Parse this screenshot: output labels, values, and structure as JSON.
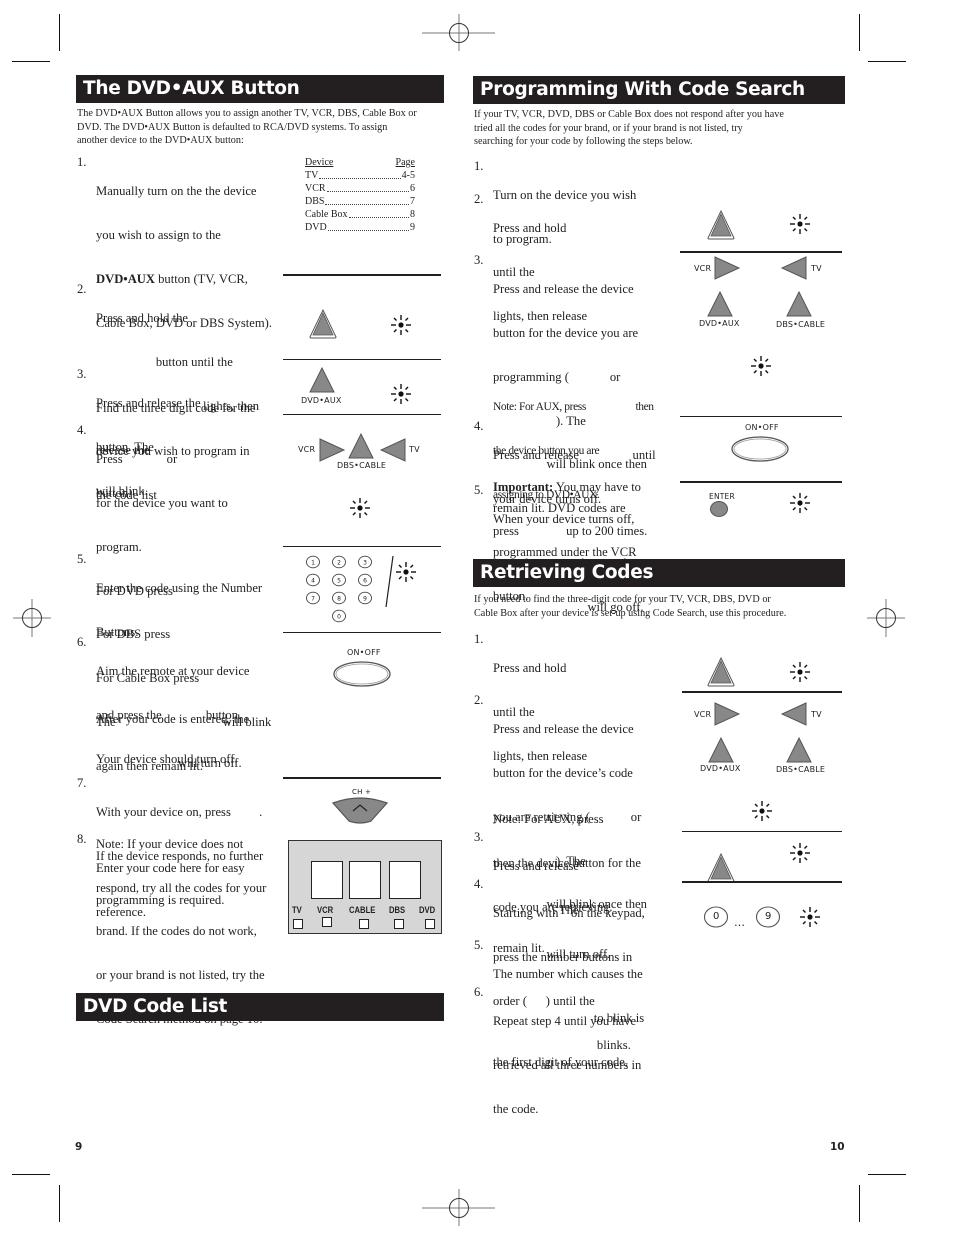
{
  "left_page": {
    "section_title": "The DVD•AUX Button",
    "intro": [
      "The DVD•AUX Button allows you to assign another TV, VCR, DBS, Cable Box or",
      "DVD. The DVD•AUX Button is defaulted to RCA/DVD systems.  To assign",
      "another device to the DVD•AUX button:"
    ],
    "steps": [
      {
        "num": "1.",
        "lines": [
          "Manually turn on the the device",
          "you wish to assign to the",
          "",
          "Cable Box, DVD or DBS System).",
          "",
          "Find the three digit code for the",
          "device you wish to program in",
          "the code list"
        ],
        "bold_line": "DVD•AUX",
        "bold_suffix": " button (TV, VCR,"
      },
      {
        "num": "2.",
        "lines": [
          "Press and hold the",
          "                   button until the",
          "                                  lights, then",
          "release the",
          "button."
        ]
      },
      {
        "num": "3.",
        "lines": [
          "Press and release the",
          "button. The",
          "will blink."
        ]
      },
      {
        "num": "4.",
        "lines": [
          "Press              or",
          "for the device you want to",
          "program.",
          "For DVD press",
          "For DBS press",
          "For Cable Box press",
          "The                                  will blink",
          "again then remain lit."
        ]
      },
      {
        "num": "5.",
        "lines": [
          "Enter the code using the Number",
          "Buttons.",
          "",
          "After your code is entered, the",
          "                          will turn off."
        ]
      },
      {
        "num": "6.",
        "lines": [
          "Aim the remote at your device",
          "and press the              button.",
          "Your device should turn off.",
          "",
          "Note: If your device does not",
          "respond, try all the codes for your",
          "brand. If the codes do not work,",
          "or your brand is not listed, try the",
          "Code Search method on page 10."
        ]
      },
      {
        "num": "7.",
        "lines": [
          "With your device on, press         .",
          "If the device responds, no further",
          "programming is required."
        ]
      },
      {
        "num": "8.",
        "lines": [
          "Enter your code here for easy",
          "reference."
        ]
      }
    ],
    "device_table": {
      "headers": [
        "Device",
        "Page"
      ],
      "rows": [
        {
          "device": "TV",
          "page": "4-5"
        },
        {
          "device": "VCR",
          "page": "6"
        },
        {
          "device": "DBS",
          "page": "7"
        },
        {
          "device": "Cable Box",
          "page": "8"
        },
        {
          "device": "DVD",
          "page": "9"
        }
      ]
    },
    "illustration_labels": {
      "dvd_aux": "DVD•AUX",
      "vcr": "VCR",
      "tv": "TV",
      "dbs_cable": "DBS•CABLE",
      "on_off": "ON•OFF",
      "ch_plus": "CH +",
      "keypad": [
        "1",
        "2",
        "3",
        "4",
        "5",
        "6",
        "7",
        "8",
        "9",
        "0"
      ]
    },
    "reference_card": {
      "devices": [
        "TV",
        "VCR",
        "CABLE",
        "DBS",
        "DVD"
      ]
    },
    "second_section_title": "DVD Code List",
    "page_number": "9"
  },
  "right_page": {
    "section_title": "Programming With Code Search",
    "intro": [
      "If your TV, VCR, DVD, DBS or Cable Box does not respond after you have",
      "tried all the codes for your brand, or if your brand is not listed, try",
      "searching for your code by following the steps below."
    ],
    "steps": [
      {
        "num": "1.",
        "lines": [
          "Turn on the device you wish",
          "to program."
        ]
      },
      {
        "num": "2.",
        "lines": [
          "Press and hold",
          "until the",
          "lights, then release"
        ]
      },
      {
        "num": "3.",
        "lines": [
          "Press and release the device",
          "button for the device you are",
          "programming (             or",
          "                    ). The",
          "                 will blink once then",
          "remain lit. DVD codes are",
          "programmed under the VCR",
          "button."
        ]
      },
      {
        "num": "",
        "lines": [
          "Note: For AUX, press                    then",
          "the device button you are",
          "assigning to DVD•AUX."
        ]
      },
      {
        "num": "4.",
        "lines": [
          "Press and release                 until",
          "your device turns off."
        ]
      },
      {
        "num": "",
        "lines": [
          "You may have to",
          "press               up to 200 times."
        ],
        "bold_prefix": "Important:"
      },
      {
        "num": "5.",
        "lines": [
          "When your device turns off,",
          "press the              button, the",
          "                              will go off."
        ]
      }
    ],
    "illustration_labels": {
      "vcr": "VCR",
      "tv": "TV",
      "dvd_aux": "DVD•AUX",
      "dbs_cable": "DBS•CABLE",
      "on_off": "ON•OFF",
      "enter": "ENTER"
    },
    "second_section": {
      "title": "Retrieving Codes",
      "intro": [
        "If you need to find the three-digit code for your TV, VCR, DBS, DVD or",
        "Cable Box after your device is set-up using Code Search, use this procedure."
      ],
      "steps": [
        {
          "num": "1.",
          "lines": [
            "Press and hold",
            "until the",
            "lights, then release"
          ]
        },
        {
          "num": "2.",
          "lines": [
            "Press and release the device",
            "button for the device’s code",
            "you are retrieving (             or",
            "                    ). The",
            "                 will blink once then",
            "remain lit."
          ]
        },
        {
          "num": "",
          "lines": [
            "Note: For AUX, press",
            "then the device button for the",
            "code you are retrieving."
          ]
        },
        {
          "num": "3.",
          "lines": [
            "Press and release",
            "                   . The",
            "                 will turn off."
          ]
        },
        {
          "num": "4.",
          "lines": [
            "Starting with    on the keypad,",
            "press the number buttons in",
            "order (      ) until the",
            "                                 blinks."
          ]
        },
        {
          "num": "5.",
          "lines": [
            "The number which causes the",
            "                                to blink is",
            "the first digit of your code."
          ]
        },
        {
          "num": "6.",
          "lines": [
            "Repeat step 4 until you have",
            "retrieved all three numbers in",
            "the code."
          ]
        }
      ],
      "illustration_labels": {
        "vcr": "VCR",
        "tv": "TV",
        "dvd_aux": "DVD•AUX",
        "dbs_cable": "DBS•CABLE",
        "key_0": "0",
        "key_9": "9",
        "ellipsis": "…"
      }
    },
    "page_number": "10"
  }
}
